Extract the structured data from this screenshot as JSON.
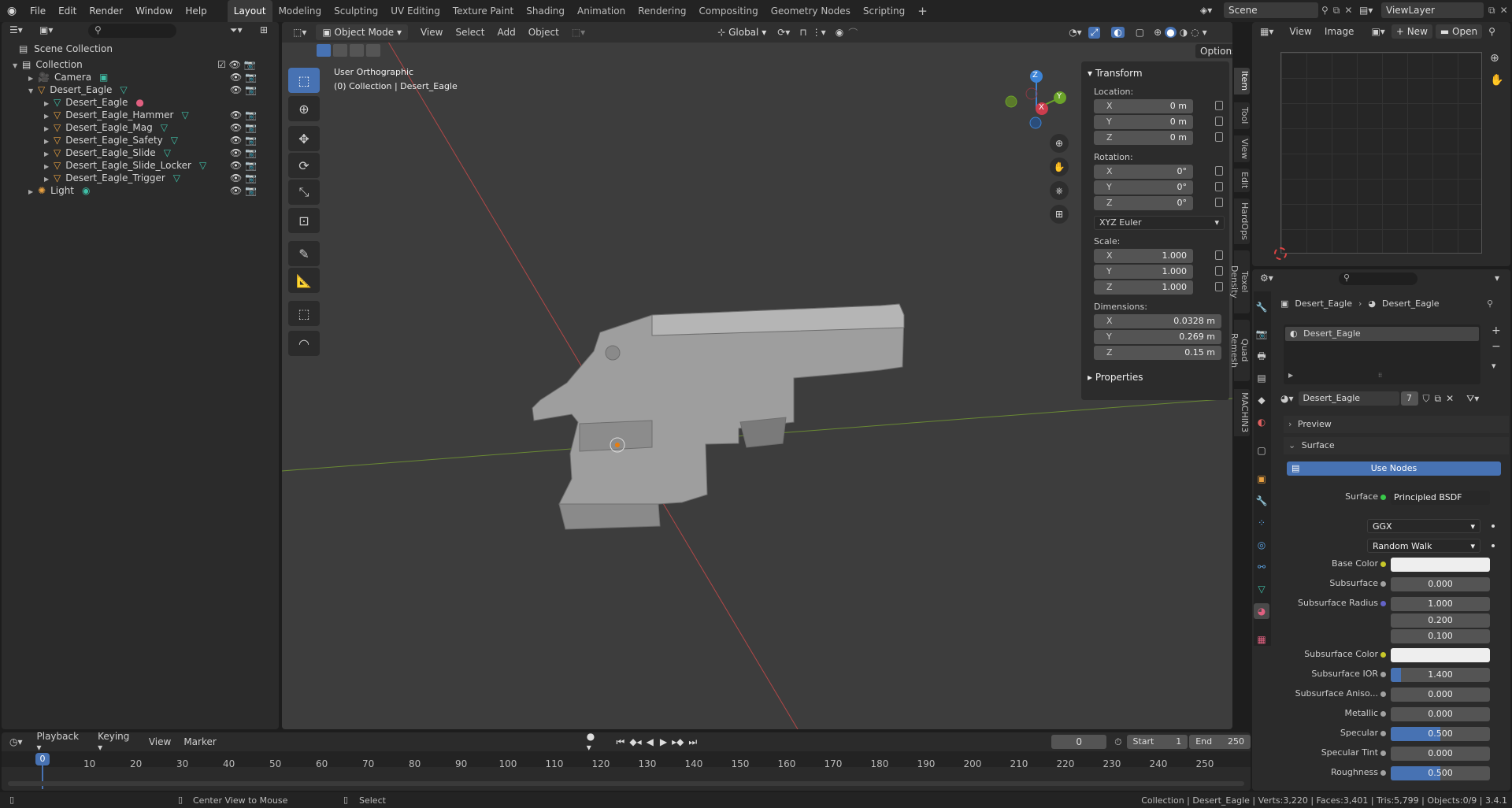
{
  "menubar": {
    "menus": [
      "File",
      "Edit",
      "Render",
      "Window",
      "Help"
    ],
    "workspaces": [
      "Layout",
      "Modeling",
      "Sculpting",
      "UV Editing",
      "Texture Paint",
      "Shading",
      "Animation",
      "Rendering",
      "Compositing",
      "Geometry Nodes",
      "Scripting"
    ],
    "active_workspace": "Layout",
    "add_tab": "+",
    "scene": "Scene",
    "view_layer": "ViewLayer"
  },
  "outliner": {
    "root": "Scene Collection",
    "items": [
      {
        "label": "Collection",
        "depth": 1,
        "icon": "collection-icon"
      },
      {
        "label": "Camera",
        "depth": 2,
        "icon": "camera-icon"
      },
      {
        "label": "Desert_Eagle",
        "depth": 2,
        "icon": "mesh-object-icon"
      },
      {
        "label": "Desert_Eagle",
        "depth": 3,
        "icon": "mesh-data-icon"
      },
      {
        "label": "Desert_Eagle_Hammer",
        "depth": 3,
        "icon": "mesh-object-icon"
      },
      {
        "label": "Desert_Eagle_Mag",
        "depth": 3,
        "icon": "mesh-object-icon"
      },
      {
        "label": "Desert_Eagle_Safety",
        "depth": 3,
        "icon": "mesh-object-icon"
      },
      {
        "label": "Desert_Eagle_Slide",
        "depth": 3,
        "icon": "mesh-object-icon"
      },
      {
        "label": "Desert_Eagle_Slide_Locker",
        "depth": 3,
        "icon": "mesh-object-icon"
      },
      {
        "label": "Desert_Eagle_Trigger",
        "depth": 3,
        "icon": "mesh-object-icon"
      },
      {
        "label": "Light",
        "depth": 2,
        "icon": "light-icon"
      }
    ]
  },
  "viewport": {
    "mode": "Object Mode",
    "menus": [
      "View",
      "Select",
      "Add",
      "Object"
    ],
    "orientation": "Global",
    "options": "Options",
    "view_name": "User Orthographic",
    "context": "(0) Collection | Desert_Eagle",
    "gizmo_x": "X",
    "gizmo_y": "Y",
    "gizmo_z": "Z"
  },
  "npanel": {
    "transform_title": "Transform",
    "location_label": "Location:",
    "location": [
      {
        "axis": "X",
        "value": "0 m"
      },
      {
        "axis": "Y",
        "value": "0 m"
      },
      {
        "axis": "Z",
        "value": "0 m"
      }
    ],
    "rotation_label": "Rotation:",
    "rotation": [
      {
        "axis": "X",
        "value": "0°"
      },
      {
        "axis": "Y",
        "value": "0°"
      },
      {
        "axis": "Z",
        "value": "0°"
      }
    ],
    "rotation_mode": "XYZ Euler",
    "scale_label": "Scale:",
    "scale": [
      {
        "axis": "X",
        "value": "1.000"
      },
      {
        "axis": "Y",
        "value": "1.000"
      },
      {
        "axis": "Z",
        "value": "1.000"
      }
    ],
    "dimensions_label": "Dimensions:",
    "dimensions": [
      {
        "axis": "X",
        "value": "0.0328 m"
      },
      {
        "axis": "Y",
        "value": "0.269 m"
      },
      {
        "axis": "Z",
        "value": "0.15 m"
      }
    ],
    "properties_title": "Properties",
    "tabs": [
      "Item",
      "Tool",
      "View",
      "Edit",
      "HardOps",
      "Texel Density",
      "Quad Remesh",
      "MACHIN3"
    ]
  },
  "image_editor": {
    "menus": [
      "View",
      "Image"
    ],
    "new_label": "New",
    "open_label": "Open"
  },
  "properties": {
    "breadcrumb_object": "Desert_Eagle",
    "breadcrumb_material": "Desert_Eagle",
    "slot_name": "Desert_Eagle",
    "material_name": "Desert_Eagle",
    "user_count": "7",
    "preview_title": "Preview",
    "surface_title": "Surface",
    "use_nodes": "Use Nodes",
    "surface_label": "Surface",
    "surface_shader": "Principled BSDF",
    "distribution": "GGX",
    "subsurface_method": "Random Walk",
    "rows": [
      {
        "label": "Base Color",
        "value": "",
        "dot": "#c7c729",
        "color": "#eeeeee"
      },
      {
        "label": "Subsurface",
        "value": "0.000",
        "dot": "#a1a1a1"
      },
      {
        "label": "Subsurface Radius",
        "value": "1.000",
        "dot": "#6363c7"
      },
      {
        "label": "",
        "value": "0.200"
      },
      {
        "label": "",
        "value": "0.100"
      },
      {
        "label": "Subsurface Color",
        "value": "",
        "dot": "#c7c729",
        "color": "#eeeeee"
      },
      {
        "label": "Subsurface IOR",
        "value": "1.400",
        "dot": "#a1a1a1",
        "fill": 0.1
      },
      {
        "label": "Subsurface Aniso...",
        "value": "0.000",
        "dot": "#a1a1a1"
      },
      {
        "label": "Metallic",
        "value": "0.000",
        "dot": "#a1a1a1"
      },
      {
        "label": "Specular",
        "value": "0.500",
        "dot": "#a1a1a1",
        "fill": 0.5
      },
      {
        "label": "Specular Tint",
        "value": "0.000",
        "dot": "#a1a1a1"
      },
      {
        "label": "Roughness",
        "value": "0.500",
        "dot": "#a1a1a1",
        "fill": 0.5
      }
    ]
  },
  "timeline": {
    "menus": [
      "Playback",
      "Keying",
      "View",
      "Marker"
    ],
    "current_frame": "0",
    "start_label": "Start",
    "start": "1",
    "end_label": "End",
    "end": "250",
    "ticks": [
      "0",
      "10",
      "20",
      "30",
      "40",
      "50",
      "60",
      "70",
      "80",
      "90",
      "100",
      "110",
      "120",
      "130",
      "140",
      "150",
      "160",
      "170",
      "180",
      "190",
      "200",
      "210",
      "220",
      "230",
      "240",
      "250"
    ]
  },
  "statusbar": {
    "hint1": "Center View to Mouse",
    "hint2": "Select",
    "stats": "Collection | Desert_Eagle | Verts:3,220 | Faces:3,401 | Tris:5,799 | Objects:0/9 | 3.4.1"
  }
}
